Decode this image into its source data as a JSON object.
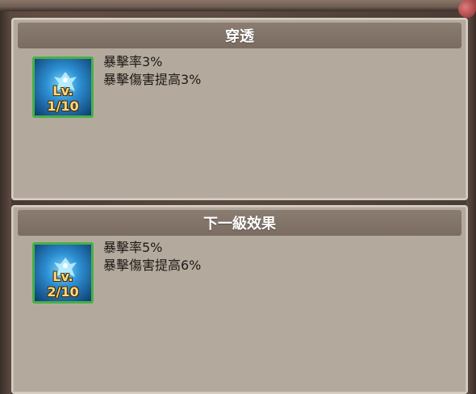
{
  "current_effect": {
    "title": "穿透",
    "level_label": "Lv. 1/10",
    "lines": [
      "暴擊率3%",
      "暴擊傷害提高3%"
    ]
  },
  "next_effect": {
    "title": "下一級效果",
    "level_label": "Lv. 2/10",
    "lines": [
      "暴擊率5%",
      "暴擊傷害提高6%"
    ]
  },
  "icons": {
    "skill_icon": "blue-bird-skill-icon"
  },
  "colors": {
    "panel_bg": "#b3aa9d",
    "header_bg": "#7b6c62",
    "icon_border": "#49b046",
    "level_text": "#ffd880"
  }
}
